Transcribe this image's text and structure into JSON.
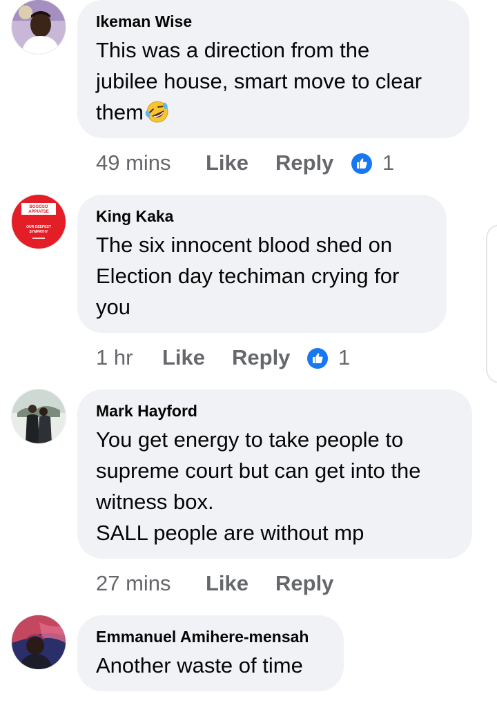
{
  "comments": [
    {
      "author": "Ikeman Wise",
      "lines": [
        "This was a direction from the",
        "jubilee house, smart move to clear",
        "them"
      ],
      "emoji": "rolling-on-floor-laughing-emoji",
      "time": "49 mins",
      "like_label": "Like",
      "reply_label": "Reply",
      "reaction_count": "1"
    },
    {
      "author": "King Kaka",
      "avatar_text": [
        "BOGOSO",
        "APPIATSE",
        "OUR DEEPEST",
        "SYMPATHY"
      ],
      "lines": [
        "The six innocent blood shed on",
        "Election day techiman crying for",
        "you"
      ],
      "time": "1 hr",
      "like_label": "Like",
      "reply_label": "Reply",
      "reaction_count": "1"
    },
    {
      "author": "Mark Hayford",
      "lines": [
        "You get energy to take people to",
        "supreme court but can get into the",
        "witness box.",
        "SALL people are without mp"
      ],
      "time": "27 mins",
      "like_label": "Like",
      "reply_label": "Reply"
    },
    {
      "author": "Emmanuel Amihere-mensah",
      "lines": [
        "Another waste of time"
      ]
    }
  ],
  "colors": {
    "bubble": "#f0f2f5",
    "meta_text": "#65676b",
    "like_blue": "#1877f2",
    "avatar_red": "#e41e26"
  }
}
